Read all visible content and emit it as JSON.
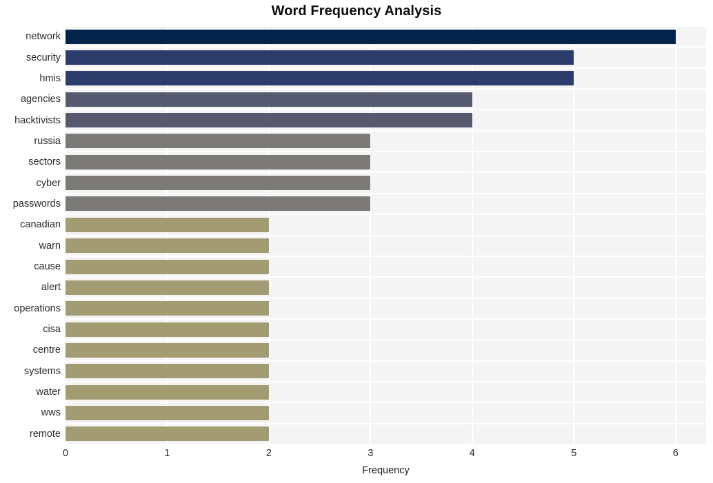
{
  "chart_data": {
    "type": "bar",
    "orientation": "horizontal",
    "title": "Word Frequency Analysis",
    "xlabel": "Frequency",
    "ylabel": "",
    "xlim": [
      0,
      6.3
    ],
    "xticks": [
      0,
      1,
      2,
      3,
      4,
      5,
      6
    ],
    "xticklabels": [
      "0",
      "1",
      "2",
      "3",
      "4",
      "5",
      "6"
    ],
    "grid": true,
    "legend": null,
    "categories": [
      "network",
      "security",
      "hmis",
      "agencies",
      "hacktivists",
      "russia",
      "sectors",
      "cyber",
      "passwords",
      "canadian",
      "warn",
      "cause",
      "alert",
      "operations",
      "cisa",
      "centre",
      "systems",
      "water",
      "wws",
      "remote"
    ],
    "values": [
      6,
      5,
      5,
      4,
      4,
      3,
      3,
      3,
      3,
      2,
      2,
      2,
      2,
      2,
      2,
      2,
      2,
      2,
      2,
      2
    ],
    "bar_colors": [
      "#03234b",
      "#2c3c6b",
      "#2c3c6b",
      "#575a6e",
      "#575a6e",
      "#7b7a76",
      "#7b7a76",
      "#7b7a76",
      "#7b7a76",
      "#a39b71",
      "#a39b71",
      "#a39b71",
      "#a39b71",
      "#a39b71",
      "#a39b71",
      "#a39b71",
      "#a39b71",
      "#a39b71",
      "#a39b71",
      "#a39b71"
    ],
    "plot_background": "#f4f4f5",
    "grid_color": "#ffffff",
    "figure_background": "#ffffff"
  }
}
